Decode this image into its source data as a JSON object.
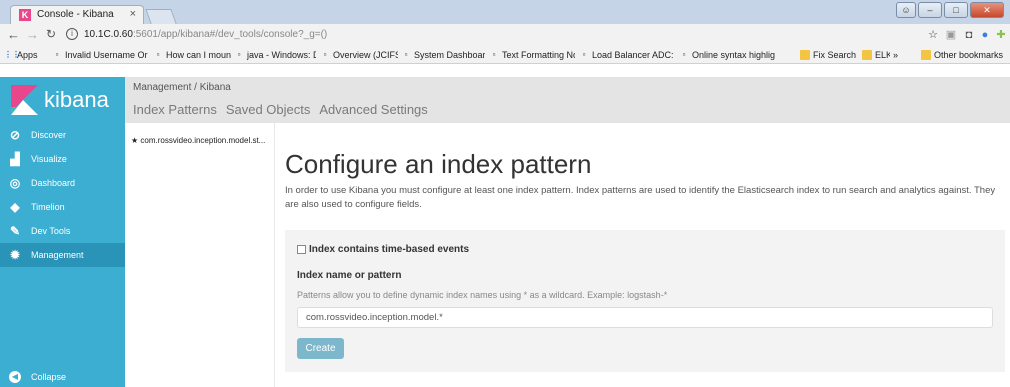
{
  "browser": {
    "tab_title": "Console - Kibana",
    "tab_close": "×",
    "url_host": "10.1C.0.60",
    "url_path": ":5601/app/kibana#/dev_tools/console?_g=()",
    "bookmarks": [
      {
        "label": "Apps",
        "icon": "apps-grid-icon"
      },
      {
        "label": "Invalid Username Or",
        "icon": "page-icon"
      },
      {
        "label": "How can I mount a w",
        "icon": "page-icon"
      },
      {
        "label": "java - Windows: Disp",
        "icon": "page-icon"
      },
      {
        "label": "Overview (JCIFS API)",
        "icon": "page-icon"
      },
      {
        "label": "System Dashboard -",
        "icon": "page-icon"
      },
      {
        "label": "Text Formatting Nota",
        "icon": "page-icon"
      },
      {
        "label": "Load Balancer ADC: S",
        "icon": "page-icon"
      },
      {
        "label": "Online syntax highlig",
        "icon": "page-icon"
      },
      {
        "label": "Fix Search",
        "icon": "folder-icon"
      },
      {
        "label": "ELK",
        "icon": "folder-icon"
      },
      {
        "label": "»",
        "icon": ""
      },
      {
        "label": "Other bookmarks",
        "icon": "folder-icon"
      }
    ]
  },
  "kibana": {
    "logo_text": "kibana",
    "nav": [
      {
        "label": "Discover",
        "icon": "compass-icon",
        "active": false
      },
      {
        "label": "Visualize",
        "icon": "bar-chart-icon",
        "active": false
      },
      {
        "label": "Dashboard",
        "icon": "dashboard-icon",
        "active": false
      },
      {
        "label": "Timelion",
        "icon": "timelion-icon",
        "active": false
      },
      {
        "label": "Dev Tools",
        "icon": "wrench-icon",
        "active": false
      },
      {
        "label": "Management",
        "icon": "gear-icon",
        "active": true
      }
    ],
    "collapse_label": "Collapse",
    "breadcrumb": "Management / Kibana",
    "subtabs": [
      "Index Patterns",
      "Saved Objects",
      "Advanced Settings"
    ],
    "pattern_list_item": "★ com.rossvideo.inception.model.st...",
    "heading": "Configure an index pattern",
    "intro": "In order to use Kibana you must configure at least one index pattern. Index patterns are used to identify the Elasticsearch index to run search and analytics against. They are also used to configure fields.",
    "time_based_label": "Index contains time-based events",
    "name_label": "Index name or pattern",
    "help_text": "Patterns allow you to define dynamic index names using * as a wildcard. Example: logstash-*",
    "pattern_value": "com.rossvideo.inception.model.*",
    "create_label": "Create"
  },
  "colors": {
    "sidebar": "#3caed2",
    "sidebar_active": "#2a93b8",
    "local_nav": "#e4e4e4",
    "button": "#7db7cc"
  }
}
